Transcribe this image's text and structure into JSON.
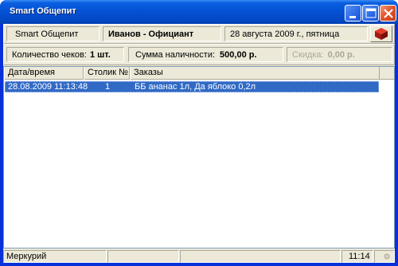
{
  "window": {
    "title": "Smart Общепит",
    "controls": [
      "minimize-icon",
      "maximize-icon",
      "close-icon"
    ]
  },
  "header": {
    "app_name": "Smart Общепит",
    "user": "Иванов - Официант",
    "date": "28 августа 2009 г., пятница",
    "logo_icon": "red-cube-icon"
  },
  "summary": {
    "checks_label": "Количество чеков:",
    "checks_value": "1 шт.",
    "cash_label": "Сумма наличности:",
    "cash_value": "500,00 р.",
    "discount_label": "Скидка:",
    "discount_value": "0,00 р."
  },
  "table": {
    "columns": [
      "Дата/время",
      "Столик №",
      "Заказы"
    ],
    "rows": [
      {
        "datetime": "28.08.2009 11:13:48",
        "table_no": "1",
        "orders": "ББ ананас 1л, Да яблоко 0,2л",
        "selected": true
      }
    ]
  },
  "statusbar": {
    "left": "Меркурий",
    "time": "11:14"
  },
  "colors": {
    "titlebar": "#0450d2",
    "selection": "#316ac5",
    "panel": "#ece9d8"
  }
}
